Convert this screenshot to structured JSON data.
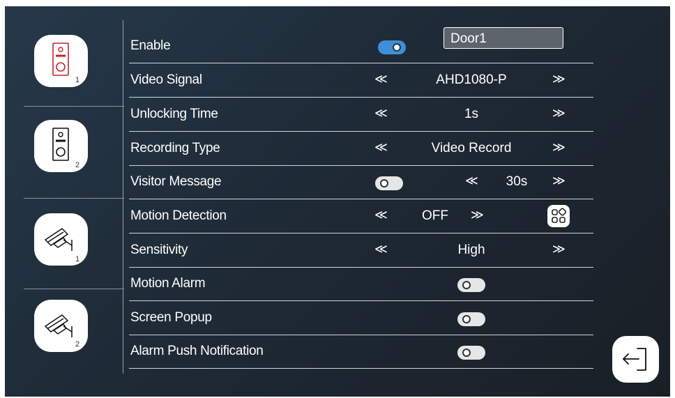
{
  "sidebar": {
    "items": [
      {
        "icon": "doorbell-icon",
        "number": "1",
        "color": "#c0262d"
      },
      {
        "icon": "doorbell-icon",
        "number": "2",
        "color": "#111111"
      },
      {
        "icon": "cctv-camera-icon",
        "number": "1",
        "color": "#111111"
      },
      {
        "icon": "cctv-camera-icon",
        "number": "2",
        "color": "#111111"
      }
    ]
  },
  "settings": {
    "enable": {
      "label": "Enable",
      "toggle": "on",
      "name": "Door1"
    },
    "video_signal": {
      "label": "Video Signal",
      "value": "AHD1080-P"
    },
    "unlocking_time": {
      "label": "Unlocking Time",
      "value": "1s"
    },
    "recording_type": {
      "label": "Recording Type",
      "value": "Video Record"
    },
    "visitor_message": {
      "label": "Visitor Message",
      "toggle": "off",
      "value": "30s"
    },
    "motion_detection": {
      "label": "Motion Detection",
      "value": "OFF",
      "icon": "grid-settings-icon"
    },
    "sensitivity": {
      "label": "Sensitivity",
      "value": "High"
    },
    "motion_alarm": {
      "label": "Motion Alarm",
      "toggle": "off"
    },
    "screen_popup": {
      "label": "Screen Popup",
      "toggle": "off"
    },
    "alarm_push": {
      "label": "Alarm Push Notification",
      "toggle": "off"
    }
  },
  "arrows": {
    "left": "≪",
    "right": "≫"
  },
  "footer": {
    "back_icon": "exit-icon"
  },
  "colors": {
    "accent": "#3e8fd9",
    "alert": "#c0262d"
  }
}
